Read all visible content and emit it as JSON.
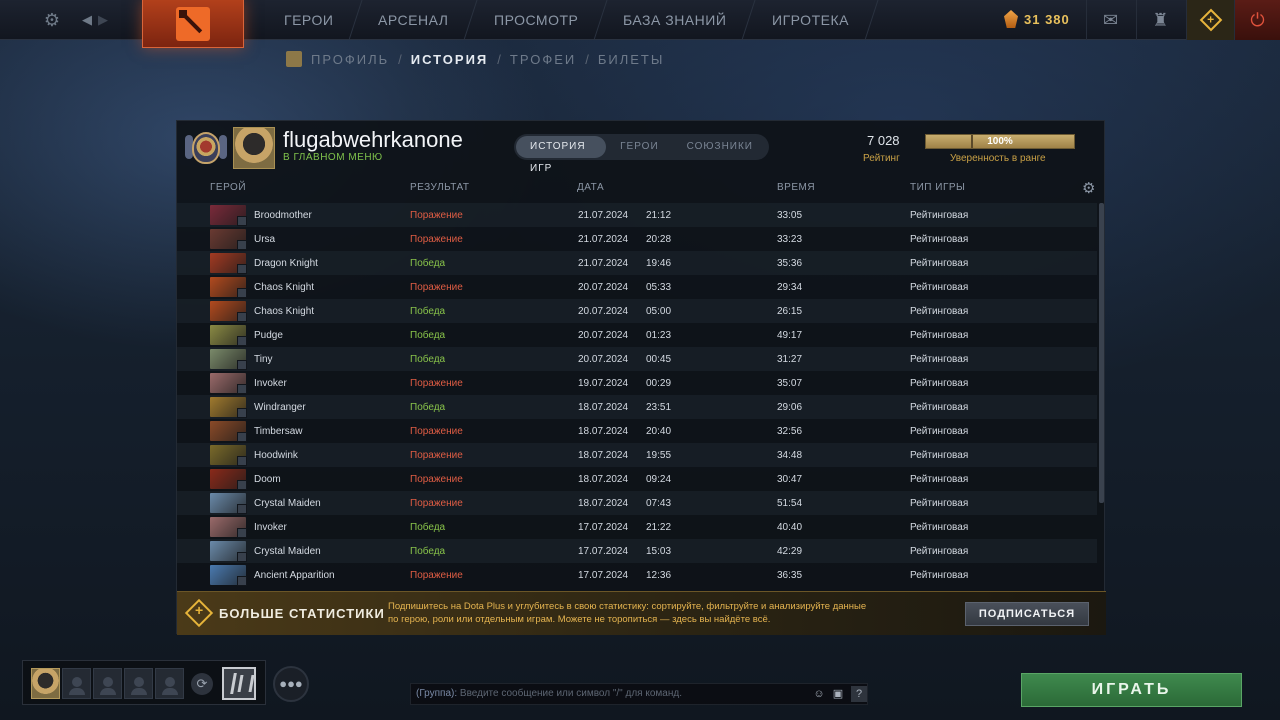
{
  "topbar": {
    "nav": [
      "ГЕРОИ",
      "АРСЕНАЛ",
      "ПРОСМОТР",
      "БАЗА ЗНАНИЙ",
      "ИГРОТЕКА"
    ],
    "currency": "31 380"
  },
  "subnav": {
    "profile": "ПРОФИЛЬ",
    "history": "ИСТОРИЯ",
    "trophies": "ТРОФЕИ",
    "tickets": "БИЛЕТЫ",
    "sep": "/"
  },
  "player": {
    "name": "flugabwehrkanone",
    "status": "В ГЛАВНОМ МЕНЮ"
  },
  "tabs": [
    "ИСТОРИЯ ИГР",
    "ГЕРОИ",
    "СОЮЗНИКИ"
  ],
  "rating": {
    "value": "7 028",
    "label": "Рейтинг",
    "confidence_percent": 100,
    "confidence_text": "100%",
    "confidence_label": "Уверенность в ранге"
  },
  "table": {
    "headers": {
      "hero": "ГЕРОЙ",
      "result": "РЕЗУЛЬТАТ",
      "date": "ДАТА",
      "duration": "ВРЕМЯ",
      "mode": "ТИП ИГРЫ"
    },
    "rows": [
      {
        "hero": "Broodmother",
        "result": "Поражение",
        "win": false,
        "date": "21.07.2024",
        "time": "21:12",
        "duration": "33:05",
        "mode": "Рейтинговая",
        "color": "#7a2a3a"
      },
      {
        "hero": "Ursa",
        "result": "Поражение",
        "win": false,
        "date": "21.07.2024",
        "time": "20:28",
        "duration": "33:23",
        "mode": "Рейтинговая",
        "color": "#6a3a32"
      },
      {
        "hero": "Dragon Knight",
        "result": "Победа",
        "win": true,
        "date": "21.07.2024",
        "time": "19:46",
        "duration": "35:36",
        "mode": "Рейтинговая",
        "color": "#a33a22"
      },
      {
        "hero": "Chaos Knight",
        "result": "Поражение",
        "win": false,
        "date": "20.07.2024",
        "time": "05:33",
        "duration": "29:34",
        "mode": "Рейтинговая",
        "color": "#b24a1e"
      },
      {
        "hero": "Chaos Knight",
        "result": "Победа",
        "win": true,
        "date": "20.07.2024",
        "time": "05:00",
        "duration": "26:15",
        "mode": "Рейтинговая",
        "color": "#b24a1e"
      },
      {
        "hero": "Pudge",
        "result": "Победа",
        "win": true,
        "date": "20.07.2024",
        "time": "01:23",
        "duration": "49:17",
        "mode": "Рейтинговая",
        "color": "#8a8a44"
      },
      {
        "hero": "Tiny",
        "result": "Победа",
        "win": true,
        "date": "20.07.2024",
        "time": "00:45",
        "duration": "31:27",
        "mode": "Рейтинговая",
        "color": "#7a8a6a"
      },
      {
        "hero": "Invoker",
        "result": "Поражение",
        "win": false,
        "date": "19.07.2024",
        "time": "00:29",
        "duration": "35:07",
        "mode": "Рейтинговая",
        "color": "#9a6a6a"
      },
      {
        "hero": "Windranger",
        "result": "Победа",
        "win": true,
        "date": "18.07.2024",
        "time": "23:51",
        "duration": "29:06",
        "mode": "Рейтинговая",
        "color": "#a07a2e"
      },
      {
        "hero": "Timbersaw",
        "result": "Поражение",
        "win": false,
        "date": "18.07.2024",
        "time": "20:40",
        "duration": "32:56",
        "mode": "Рейтинговая",
        "color": "#8a4a28"
      },
      {
        "hero": "Hoodwink",
        "result": "Поражение",
        "win": false,
        "date": "18.07.2024",
        "time": "19:55",
        "duration": "34:48",
        "mode": "Рейтинговая",
        "color": "#7a6a2a"
      },
      {
        "hero": "Doom",
        "result": "Поражение",
        "win": false,
        "date": "18.07.2024",
        "time": "09:24",
        "duration": "30:47",
        "mode": "Рейтинговая",
        "color": "#8a2a1a"
      },
      {
        "hero": "Crystal Maiden",
        "result": "Поражение",
        "win": false,
        "date": "18.07.2024",
        "time": "07:43",
        "duration": "51:54",
        "mode": "Рейтинговая",
        "color": "#6a8aaa"
      },
      {
        "hero": "Invoker",
        "result": "Победа",
        "win": true,
        "date": "17.07.2024",
        "time": "21:22",
        "duration": "40:40",
        "mode": "Рейтинговая",
        "color": "#9a6a6a"
      },
      {
        "hero": "Crystal Maiden",
        "result": "Победа",
        "win": true,
        "date": "17.07.2024",
        "time": "15:03",
        "duration": "42:29",
        "mode": "Рейтинговая",
        "color": "#6a8aaa"
      },
      {
        "hero": "Ancient Apparition",
        "result": "Поражение",
        "win": false,
        "date": "17.07.2024",
        "time": "12:36",
        "duration": "36:35",
        "mode": "Рейтинговая",
        "color": "#4a7ab0"
      }
    ]
  },
  "plus_banner": {
    "title": "БОЛЬШЕ СТАТИСТИКИ",
    "text": "Подпишитесь на Dota Plus и углубитесь в свою статистику: сортируйте, фильтруйте и анализируйте данные по герою, роли или отдельным играм. Можете не торопиться — здесь вы найдёте всё.",
    "button": "ПОДПИСАТЬСЯ"
  },
  "chat": {
    "prefix": "(Группа):",
    "placeholder": "Введите сообщение или символ \"/\" для команд."
  },
  "play_button": "ИГРАТЬ",
  "colors": {
    "loss": "#e05d44",
    "win": "#88c34a",
    "gold": "#c9a146",
    "play": "#3f8a4e"
  }
}
